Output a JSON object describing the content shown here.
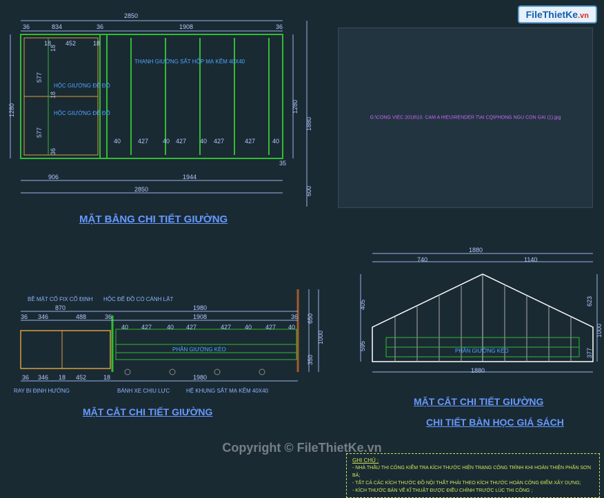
{
  "logo": {
    "brand": "FileThietKe",
    "suffix": ".vn"
  },
  "watermark": "Copyright © FileThietKe.vn",
  "titles": {
    "top": "MẶT BẰNG CHI TIẾT GIƯỜNG",
    "left": "MẶT CẮT CHI TIẾT GIƯỜNG",
    "right": "MẶT CẮT CHI TIẾT GIƯỜNG",
    "sub": "CHI TIẾT BÀN HỌC GIÁ SÁCH"
  },
  "plan": {
    "dims_top": {
      "seg1": "36",
      "seg2": "834",
      "seg3": "36",
      "seg4": "1908",
      "seg5": "36",
      "total": "2850"
    },
    "dims_sub": {
      "a": "452",
      "b": "18",
      "c": "18"
    },
    "dims_left": {
      "h": "1280",
      "s1": "577",
      "s2": "577",
      "s3": "18",
      "s4": "18",
      "s5": "36"
    },
    "dims_right": {
      "h1": "1280",
      "h2": "1880",
      "h3": "600"
    },
    "dims_int": {
      "a": "40",
      "b": "427",
      "c": "40",
      "d": "427",
      "e": "40",
      "f": "427",
      "g": "427",
      "h": "40"
    },
    "dims_bot": {
      "a": "906",
      "b": "1944",
      "total": "2850",
      "ext": "35"
    },
    "labels": {
      "frame": "THANH GIƯỜNG SẮT HỘP MẠ KẼM 40X40",
      "shelf1": "HỘC GIƯỜNG ĐỂ ĐỒ",
      "shelf2": "HỘC GIƯỜNG ĐỂ ĐỒ"
    }
  },
  "section_left": {
    "dims_top": {
      "a": "870",
      "b": "1980"
    },
    "dims_sub": {
      "a": "36",
      "b": "346",
      "c": "488",
      "d": "36",
      "e": "1908",
      "f": "36"
    },
    "dims_int": {
      "a": "40",
      "b": "427",
      "c": "40",
      "d": "427",
      "e": "427",
      "f": "40",
      "g": "427",
      "h": "40"
    },
    "dims_bot": {
      "a": "346",
      "b": "18",
      "c": "452",
      "d": "18",
      "e": "1980",
      "f": "36"
    },
    "dims_right": {
      "h": "1000",
      "s": "650",
      "t": "350"
    },
    "labels": {
      "t1": "BỀ MẶT CỐ FIX CỐ ĐỊNH",
      "t2": "HỘC ĐỂ ĐỒ CÓ CÁNH LẬT",
      "b1": "RAY BI ĐỊNH HƯỚNG",
      "b2": "BÁNH XE CHỊU LỰC",
      "b3": "HỆ KHUNG SẮT MẠ KẼM 40X40",
      "p": "PHẦN GIƯỜNG KÉO"
    }
  },
  "section_right": {
    "dims_top": {
      "a": "740",
      "b": "1140",
      "total": "1880"
    },
    "dims_bot": {
      "total": "1880"
    },
    "dims_left": {
      "a": "405",
      "b": "595"
    },
    "dims_right": {
      "h": "1000",
      "b": "377",
      "t": "623"
    },
    "labels": {
      "p": "PHẦN GIƯỜNG KÉO"
    }
  },
  "panel": {
    "path": "G:\\CONG VIEC 2018\\10. CAM A HIEU\\RENDER T\\AI CQ\\PHONG NGU CON GAI (1).jpg"
  },
  "note": {
    "title": "GHI CHÚ :",
    "l1": "- NHÀ THẦU THI CÔNG KIỂM TRA KÍCH THƯỚC HIỆN TRẠNG CÔNG TRÌNH KHI HOÀN THIỆN PHẦN SƠN BẢ;",
    "l2": "- TẤT CẢ CÁC KÍCH THƯỚC ĐỒ NỘI THẤT PHẢI THEO KÍCH THƯỚC HOÀN CÔNG ĐIỂM XÂY DỰNG;",
    "l3": "- KÍCH THƯỚC BẢN VẼ KĨ THUẬT ĐƯỢC ĐIỀU CHỈNH TRƯỚC LÚC THI CÔNG ;"
  }
}
